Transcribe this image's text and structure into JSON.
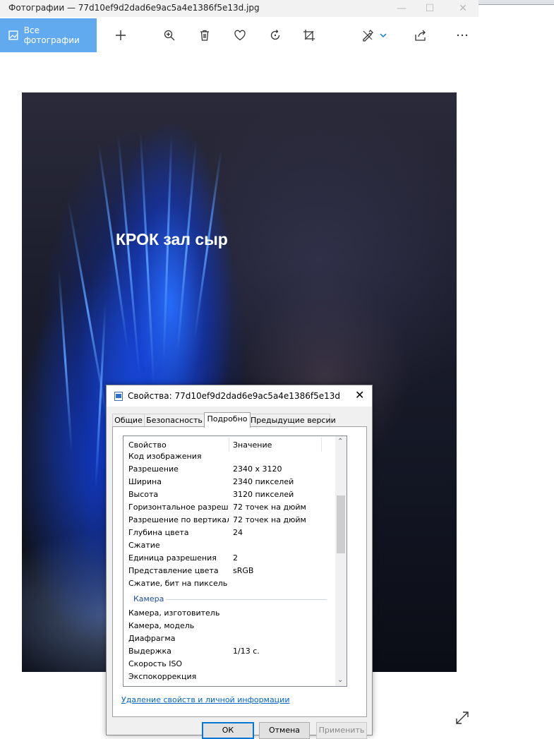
{
  "window": {
    "title": "Фотографии — 77d10ef9d2dad6e9ac5a4e1386f5e13d.jpg"
  },
  "toolbar": {
    "all_photos_label": "Все фотографии",
    "icons": [
      "add-icon",
      "zoom-in-icon",
      "delete-icon",
      "favorite-icon",
      "rotate-icon",
      "crop-icon",
      "edit-icon",
      "share-icon",
      "more-icon"
    ]
  },
  "photo": {
    "caption": "КРОК зал сыр"
  },
  "dialog": {
    "title": "Свойства: 77d10ef9d2dad6e9ac5a4e1386f5e13d",
    "tabs": [
      "Общие",
      "Безопасность",
      "Подробно",
      "Предыдущие версии"
    ],
    "active_tab": "Подробно",
    "columns": {
      "property": "Свойство",
      "value": "Значение"
    },
    "rows": [
      {
        "k": "Код изображения",
        "v": ""
      },
      {
        "k": "Разрешение",
        "v": "2340 x 3120"
      },
      {
        "k": "Ширина",
        "v": "2340 пикселей"
      },
      {
        "k": "Высота",
        "v": "3120 пикселей"
      },
      {
        "k": "Горизонтальное разреше...",
        "v": "72 точек на дюйм"
      },
      {
        "k": "Разрешение по вертикали",
        "v": "72 точек на дюйм"
      },
      {
        "k": "Глубина цвета",
        "v": "24"
      },
      {
        "k": "Сжатие",
        "v": ""
      },
      {
        "k": "Единица разрешения",
        "v": "2"
      },
      {
        "k": "Представление цвета",
        "v": "sRGB"
      },
      {
        "k": "Сжатие, бит на пиксель",
        "v": ""
      }
    ],
    "group_camera": "Камера",
    "camera_rows": [
      {
        "k": "Камера, изготовитель",
        "v": ""
      },
      {
        "k": "Камера, модель",
        "v": ""
      },
      {
        "k": "Диафрагма",
        "v": ""
      },
      {
        "k": "Выдержка",
        "v": "1/13 с."
      },
      {
        "k": "Скорость ISO",
        "v": ""
      },
      {
        "k": "Экспокоррекция",
        "v": ""
      }
    ],
    "remove_link": "Удаление свойств и личной информации",
    "buttons": {
      "ok": "ОК",
      "cancel": "Отмена",
      "apply": "Применить"
    }
  }
}
